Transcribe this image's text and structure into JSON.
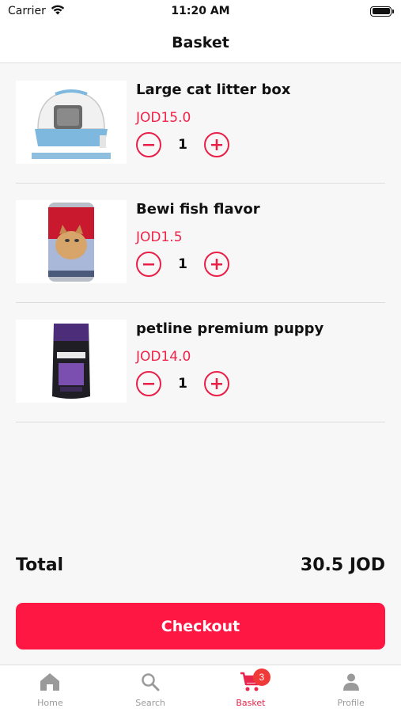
{
  "status_bar": {
    "carrier": "Carrier",
    "time": "11:20 AM"
  },
  "header": {
    "title": "Basket"
  },
  "cart": {
    "items": [
      {
        "name": "Large cat litter box",
        "price": "JOD15.0",
        "quantity": "1",
        "image_icon": "cat-litter-box-image"
      },
      {
        "name": "Bewi fish flavor",
        "price": "JOD1.5",
        "quantity": "1",
        "image_icon": "cat-food-can-image"
      },
      {
        "name": "petline premium puppy",
        "price": "JOD14.0",
        "quantity": "1",
        "image_icon": "dog-food-bag-image"
      }
    ]
  },
  "summary": {
    "total_label": "Total",
    "total_value": "30.5 JOD"
  },
  "checkout": {
    "label": "Checkout"
  },
  "tab_bar": {
    "tabs": [
      {
        "label": "Home",
        "icon": "home-icon"
      },
      {
        "label": "Search",
        "icon": "search-icon"
      },
      {
        "label": "Basket",
        "icon": "cart-icon",
        "badge": "3",
        "active": true
      },
      {
        "label": "Profile",
        "icon": "person-icon"
      }
    ]
  },
  "colors": {
    "accent": "#ff1744",
    "price": "#f0234a",
    "inactive": "#9a9a9a",
    "badge": "#f03a3a"
  }
}
